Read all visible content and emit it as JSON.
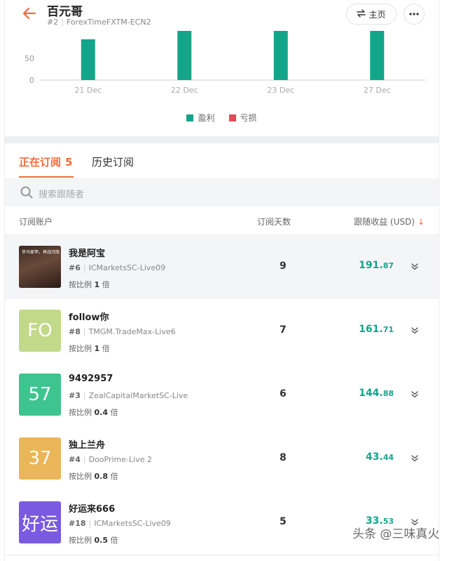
{
  "header": {
    "title": "百元哥",
    "rank": "#2",
    "server": "ForexTimeFXTM-ECN2",
    "home_label": "主页"
  },
  "colors": {
    "accent": "#f26b3a",
    "profit": "#13a58a",
    "loss": "#e24b5a"
  },
  "chart_data": {
    "type": "bar",
    "categories": [
      "21 Dec",
      "22 Dec",
      "23 Dec",
      "27 Dec"
    ],
    "series": [
      {
        "name": "盈利",
        "color": "#13a58a",
        "values": [
          80,
          120,
          120,
          120
        ]
      },
      {
        "name": "亏损",
        "color": "#e24b5a",
        "values": [
          0,
          0,
          0,
          0
        ]
      }
    ],
    "yticks": [
      "0",
      "50"
    ],
    "ylim": [
      0,
      100
    ],
    "legend": "bottom-center"
  },
  "tabs": {
    "active_label": "正在订阅",
    "active_count": "5",
    "history_label": "历史订阅"
  },
  "search": {
    "placeholder": "搜索跟随者"
  },
  "table": {
    "col_account": "订阅账户",
    "col_days": "订阅天数",
    "col_profit": "跟随收益 (USD)",
    "sort_arrow": "↓",
    "ratio_prefix": "按比例",
    "ratio_suffix": "倍",
    "rows": [
      {
        "name": "我是阿宝",
        "avatar_text": "",
        "avatar_caption": "世马家甲，再战河南",
        "avatar_color": "#4a3a30",
        "rank": "#6",
        "server": "ICMarketsSC-Live09",
        "ratio": "1",
        "days": "9",
        "profit_int": "191.",
        "profit_dec": "87"
      },
      {
        "name": "follow你",
        "avatar_text": "FO",
        "avatar_color": "#c3d98a",
        "rank": "#8",
        "server": "TMGM.TradeMax-Live6",
        "ratio": "1",
        "days": "7",
        "profit_int": "161.",
        "profit_dec": "71"
      },
      {
        "name": "9492957",
        "avatar_text": "57",
        "avatar_color": "#3ec48e",
        "rank": "#3",
        "server": "ZealCapitalMarketSC-Live",
        "ratio": "0.4",
        "days": "6",
        "profit_int": "144.",
        "profit_dec": "88"
      },
      {
        "name": "独上兰舟",
        "avatar_text": "37",
        "avatar_color": "#ebb55a",
        "rank": "#4",
        "server": "DooPrime-Live 2",
        "ratio": "0.8",
        "days": "8",
        "profit_int": "43.",
        "profit_dec": "44"
      },
      {
        "name": "好运来666",
        "avatar_text": "好运",
        "avatar_color": "#7a5ae0",
        "rank": "#18",
        "server": "ICMarketsSC-Live09",
        "ratio": "0.5",
        "days": "5",
        "profit_int": "33.",
        "profit_dec": "53"
      }
    ]
  },
  "watermark": "头条 @三味真火"
}
